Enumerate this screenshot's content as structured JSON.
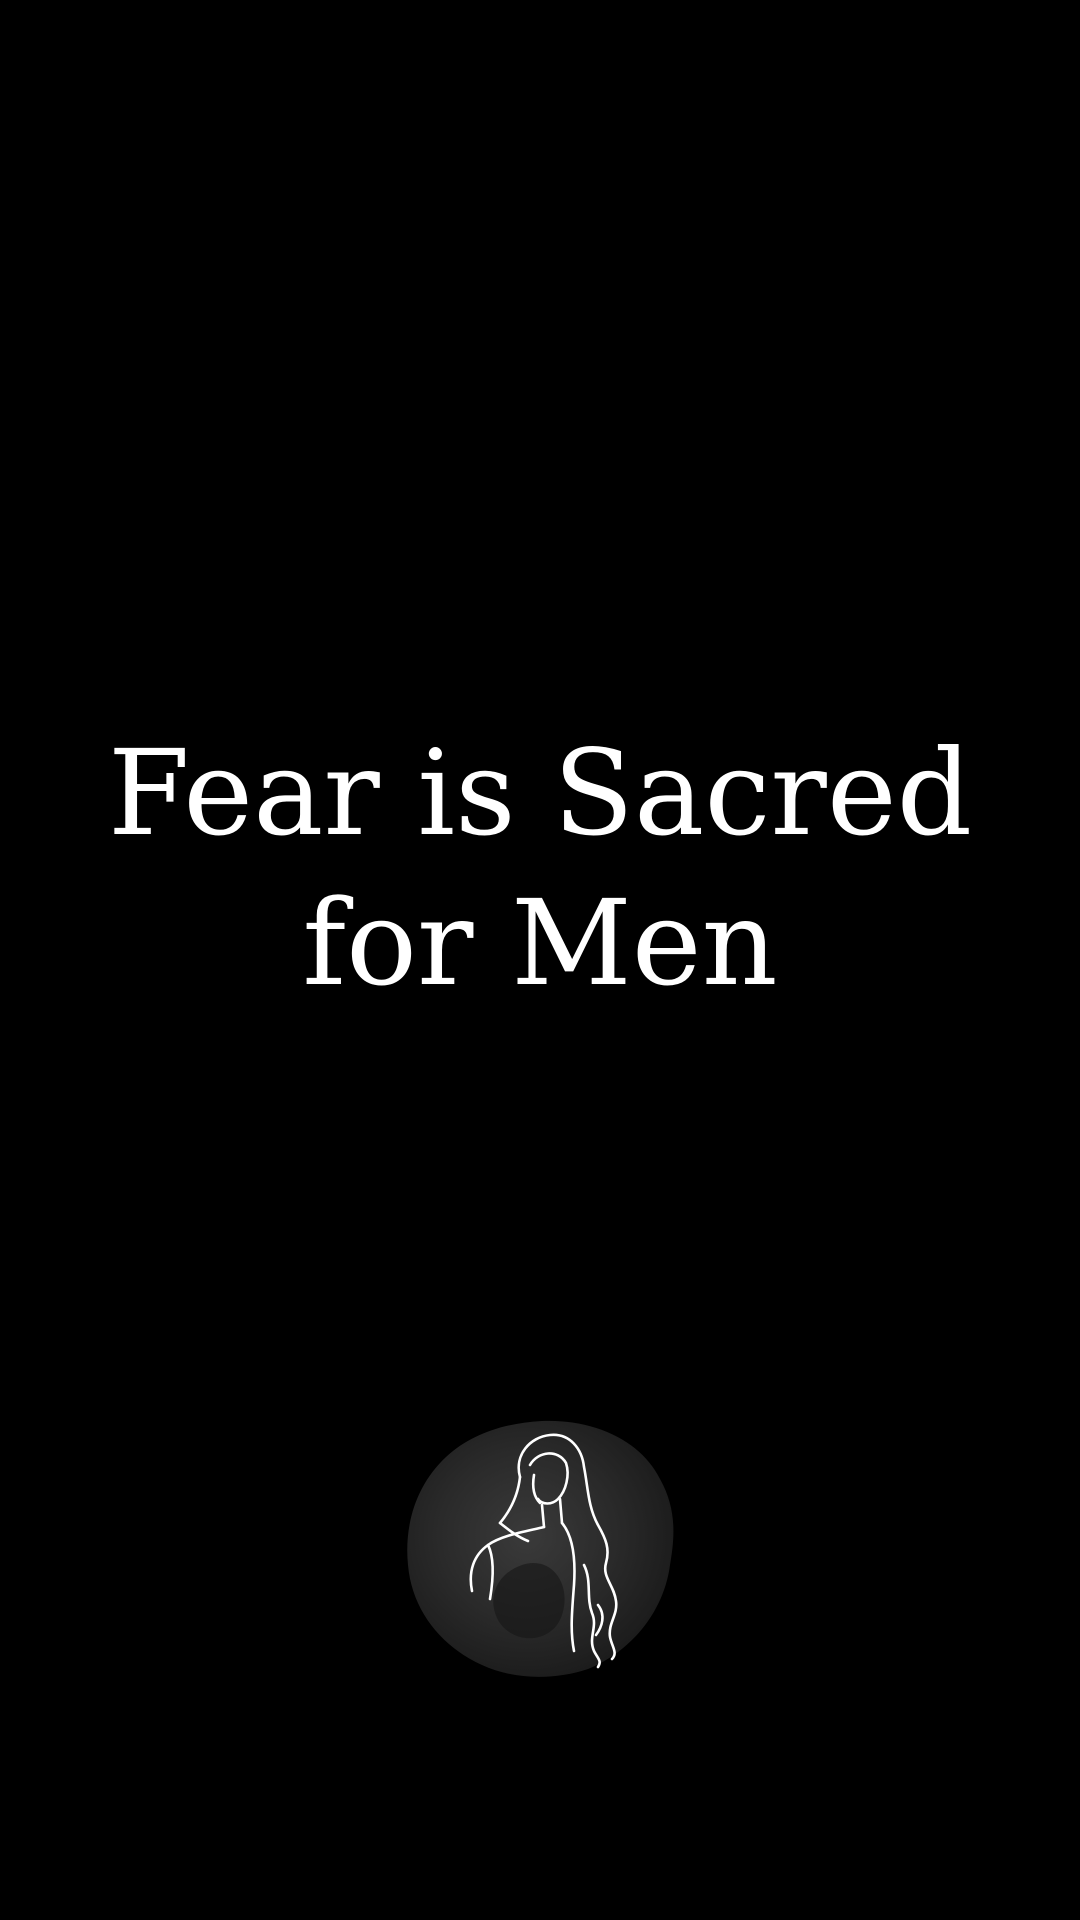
{
  "title": {
    "line1": "Fear is Sacred",
    "line2": "for Men"
  },
  "logo": {
    "icon": "woman-line-art-icon",
    "stroke_color": "#ffffff",
    "fill_color": "#2b2b2b"
  },
  "colors": {
    "background": "#000000",
    "text": "#ffffff"
  }
}
